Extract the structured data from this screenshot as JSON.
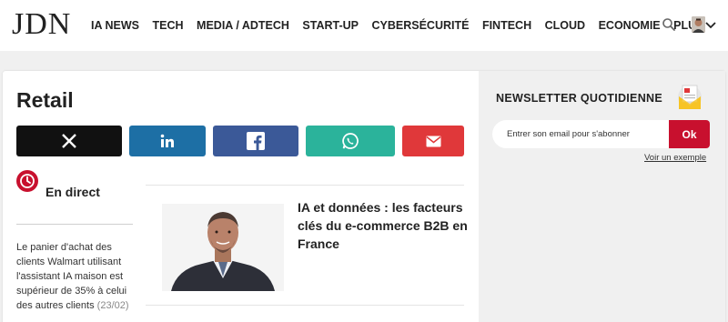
{
  "header": {
    "logo": "JDN",
    "nav": [
      "IA NEWS",
      "TECH",
      "MEDIA / ADTECH",
      "START-UP",
      "CYBERSÉCURITÉ",
      "FINTECH",
      "CLOUD",
      "ECONOMIE"
    ],
    "more_label": "PLUS",
    "search_icon": "search-icon",
    "avatar_icon": "user-avatar"
  },
  "page": {
    "title": "Retail"
  },
  "share": {
    "icons": [
      "x-icon",
      "linkedin-icon",
      "facebook-icon",
      "whatsapp-icon",
      "mail-icon"
    ],
    "colors": [
      "#111111",
      "#1d6fa5",
      "#3b5998",
      "#2bb39b",
      "#e0383a"
    ]
  },
  "live": {
    "label": "En direct",
    "text": "Le panier d'achat des clients Walmart utilisant l'assistant IA maison est supérieur de 35% à celui des autres clients",
    "date": "(23/02)"
  },
  "article": {
    "title": "IA et données : les facteurs clés du e-commerce B2B en France"
  },
  "newsletter": {
    "title": "NEWSLETTER QUOTIDIENNE",
    "placeholder": "Entrer son email pour s'abonner",
    "button": "Ok",
    "example_link": "Voir un exemple"
  },
  "colors": {
    "accent": "#c8102e"
  }
}
